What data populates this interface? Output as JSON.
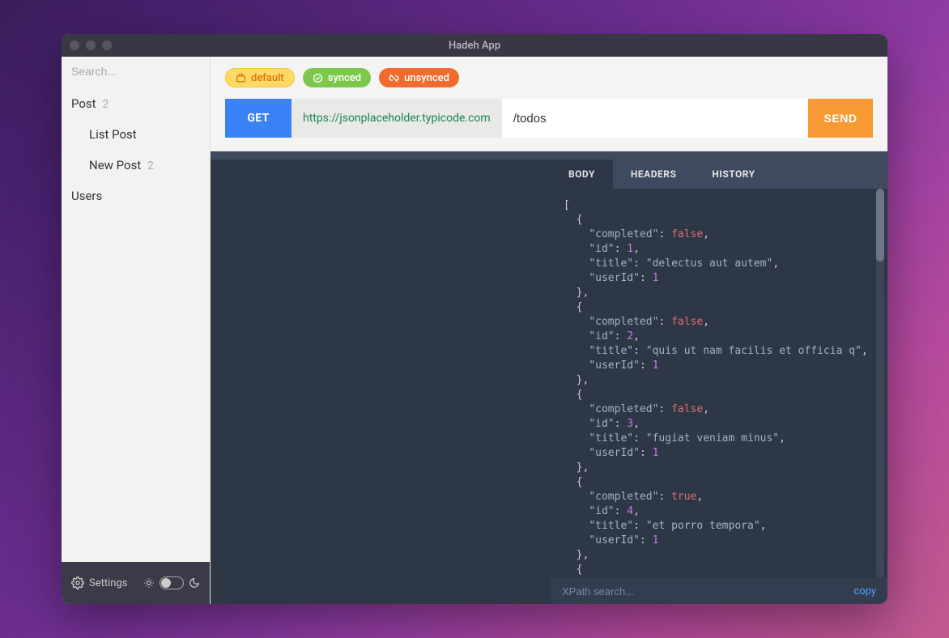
{
  "window": {
    "title": "Hadeh App"
  },
  "sidebar": {
    "search_placeholder": "Search...",
    "groups": [
      {
        "label": "Post",
        "count": "2",
        "items": [
          {
            "label": "List Post",
            "count": ""
          },
          {
            "label": "New Post",
            "count": "2"
          }
        ]
      },
      {
        "label": "Users",
        "count": "",
        "items": []
      }
    ],
    "settings_label": "Settings"
  },
  "badges": {
    "default": "default",
    "synced": "synced",
    "unsynced": "unsynced"
  },
  "request": {
    "method": "GET",
    "base_url": "https://jsonplaceholder.typicode.com",
    "path": "/todos",
    "send_label": "SEND"
  },
  "tabs": {
    "body": "BODY",
    "headers": "HEADERS",
    "history": "HISTORY",
    "active": "body"
  },
  "response_footer": {
    "xpath_placeholder": "XPath search...",
    "copy_label": "copy"
  },
  "response_items": [
    {
      "completed": false,
      "id": 1,
      "title": "delectus aut autem",
      "userId": 1
    },
    {
      "completed": false,
      "id": 2,
      "title": "quis ut nam facilis et officia q",
      "userId": 1
    },
    {
      "completed": false,
      "id": 3,
      "title": "fugiat veniam minus",
      "userId": 1
    },
    {
      "completed": true,
      "id": 4,
      "title": "et porro tempora",
      "userId": 1
    }
  ]
}
